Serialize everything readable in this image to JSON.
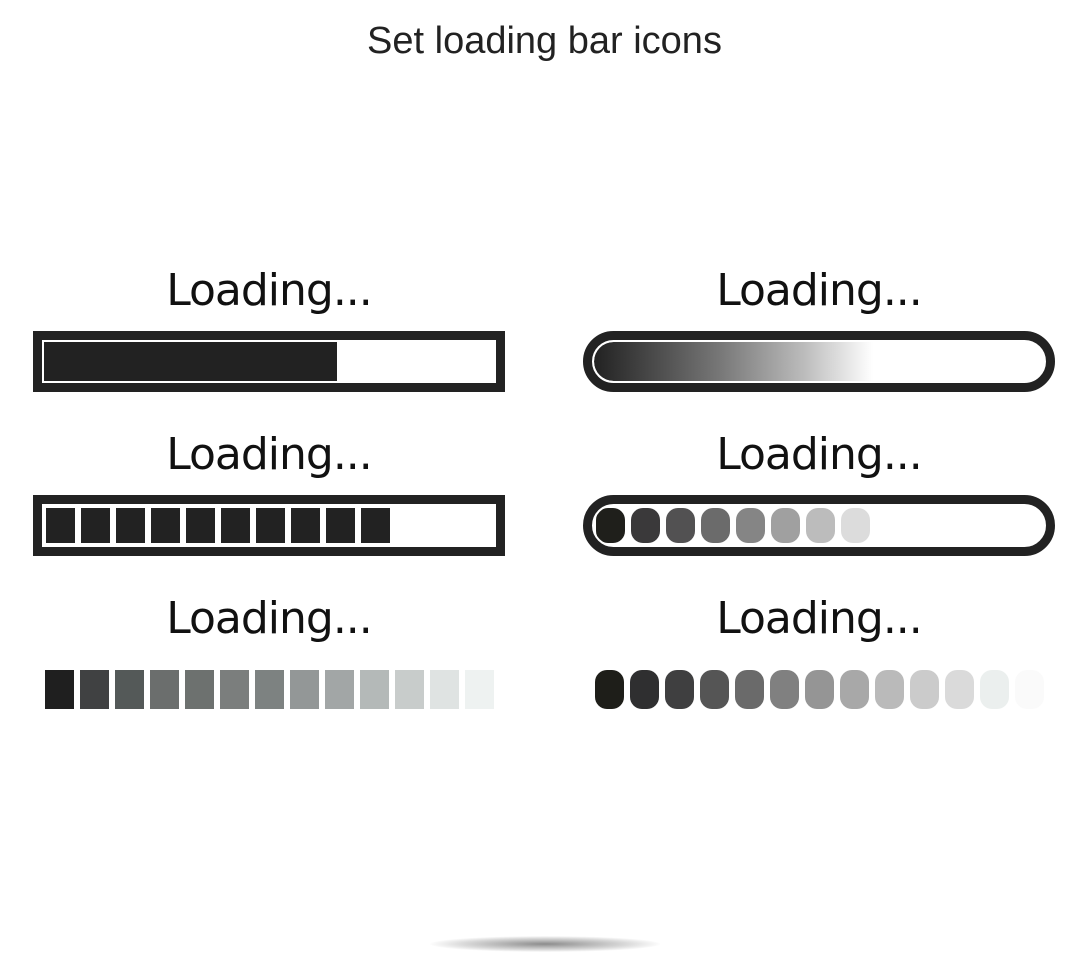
{
  "title": "Set loading bar icons",
  "loaders": [
    {
      "id": "solid-rect",
      "label": "Loading...",
      "style": "rectangular-solid",
      "progress_percent": 65,
      "color": "#222222"
    },
    {
      "id": "gradient-pill",
      "label": "Loading...",
      "style": "rounded-gradient",
      "progress_percent": 62,
      "color": "#222222"
    },
    {
      "id": "segmented-rect",
      "label": "Loading...",
      "style": "rectangular-segmented",
      "segments_filled": 10,
      "segments_total": 13,
      "color": "#222222"
    },
    {
      "id": "segmented-pill",
      "label": "Loading...",
      "style": "rounded-segmented-gradient",
      "segments_filled": 8,
      "segments_total": 13,
      "segment_colors": [
        "#1f1f1b",
        "#3a393a",
        "#525152",
        "#6b6b6b",
        "#858585",
        "#a0a0a0",
        "#bcbcbc",
        "#dcdcdc"
      ]
    },
    {
      "id": "squares-fade",
      "label": "Loading...",
      "style": "square-blocks-fade",
      "segments_total": 13,
      "segment_colors": [
        "#1f1f1f",
        "#404142",
        "#545958",
        "#6b6e6d",
        "#6d716f",
        "#7b7e7d",
        "#7d8281",
        "#939797",
        "#a2a6a6",
        "#b4b9b8",
        "#c8cccb",
        "#dfe3e2",
        "#eef2f1"
      ]
    },
    {
      "id": "rounded-fade",
      "label": "Loading...",
      "style": "rounded-blocks-fade",
      "segments_total": 13,
      "segment_colors": [
        "#1e1e19",
        "#2f2f30",
        "#3f3f40",
        "#555555",
        "#6a6a6a",
        "#808080",
        "#959595",
        "#a8a8a8",
        "#bababa",
        "#cbcbcb",
        "#dadada",
        "#ebefee",
        "#fafafa"
      ]
    }
  ]
}
